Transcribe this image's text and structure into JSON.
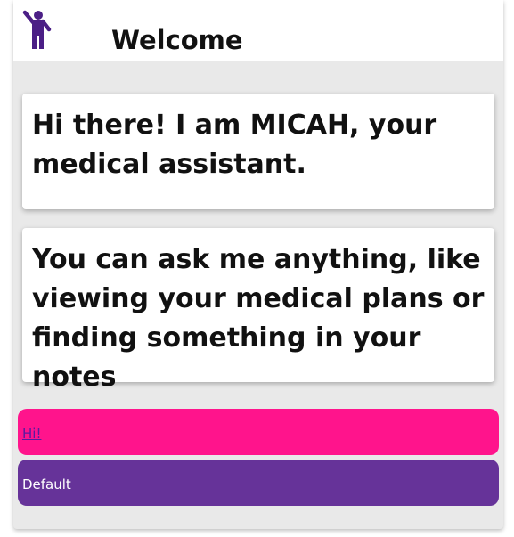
{
  "header": {
    "title": "Welcome",
    "icon": "person-waving-icon",
    "icon_color": "#4b1f86"
  },
  "messages": [
    {
      "text": "Hi there! I am MICAH, your medical assistant."
    },
    {
      "text": "You can ask me anything, like viewing your medical plans or finding something in your notes"
    }
  ],
  "actions": [
    {
      "label": "Hi!",
      "color": "#ff148c"
    },
    {
      "label": "Default",
      "color": "#663399"
    }
  ]
}
